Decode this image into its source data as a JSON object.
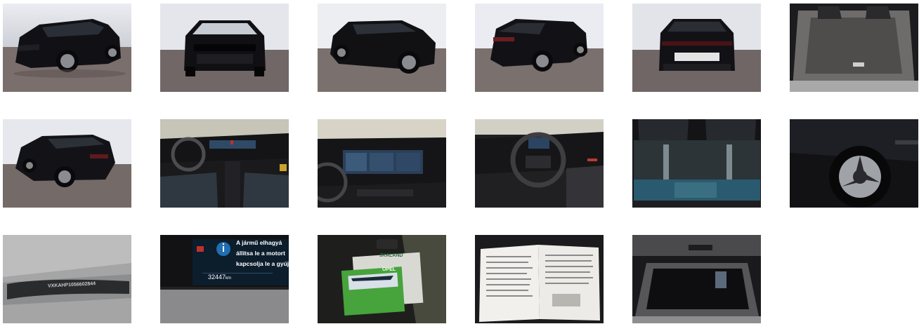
{
  "gallery": {
    "odometer": {
      "message_line1": "A jármű elhagyá",
      "message_line2": "állítsa le a motort",
      "message_line3": "kapcsolja le a gyújt",
      "mileage": "32447",
      "unit": "km"
    },
    "vin_label": "VXKAHP1056602844",
    "brochure_brand": "OPEL",
    "brochure_header": "JKALAND"
  }
}
